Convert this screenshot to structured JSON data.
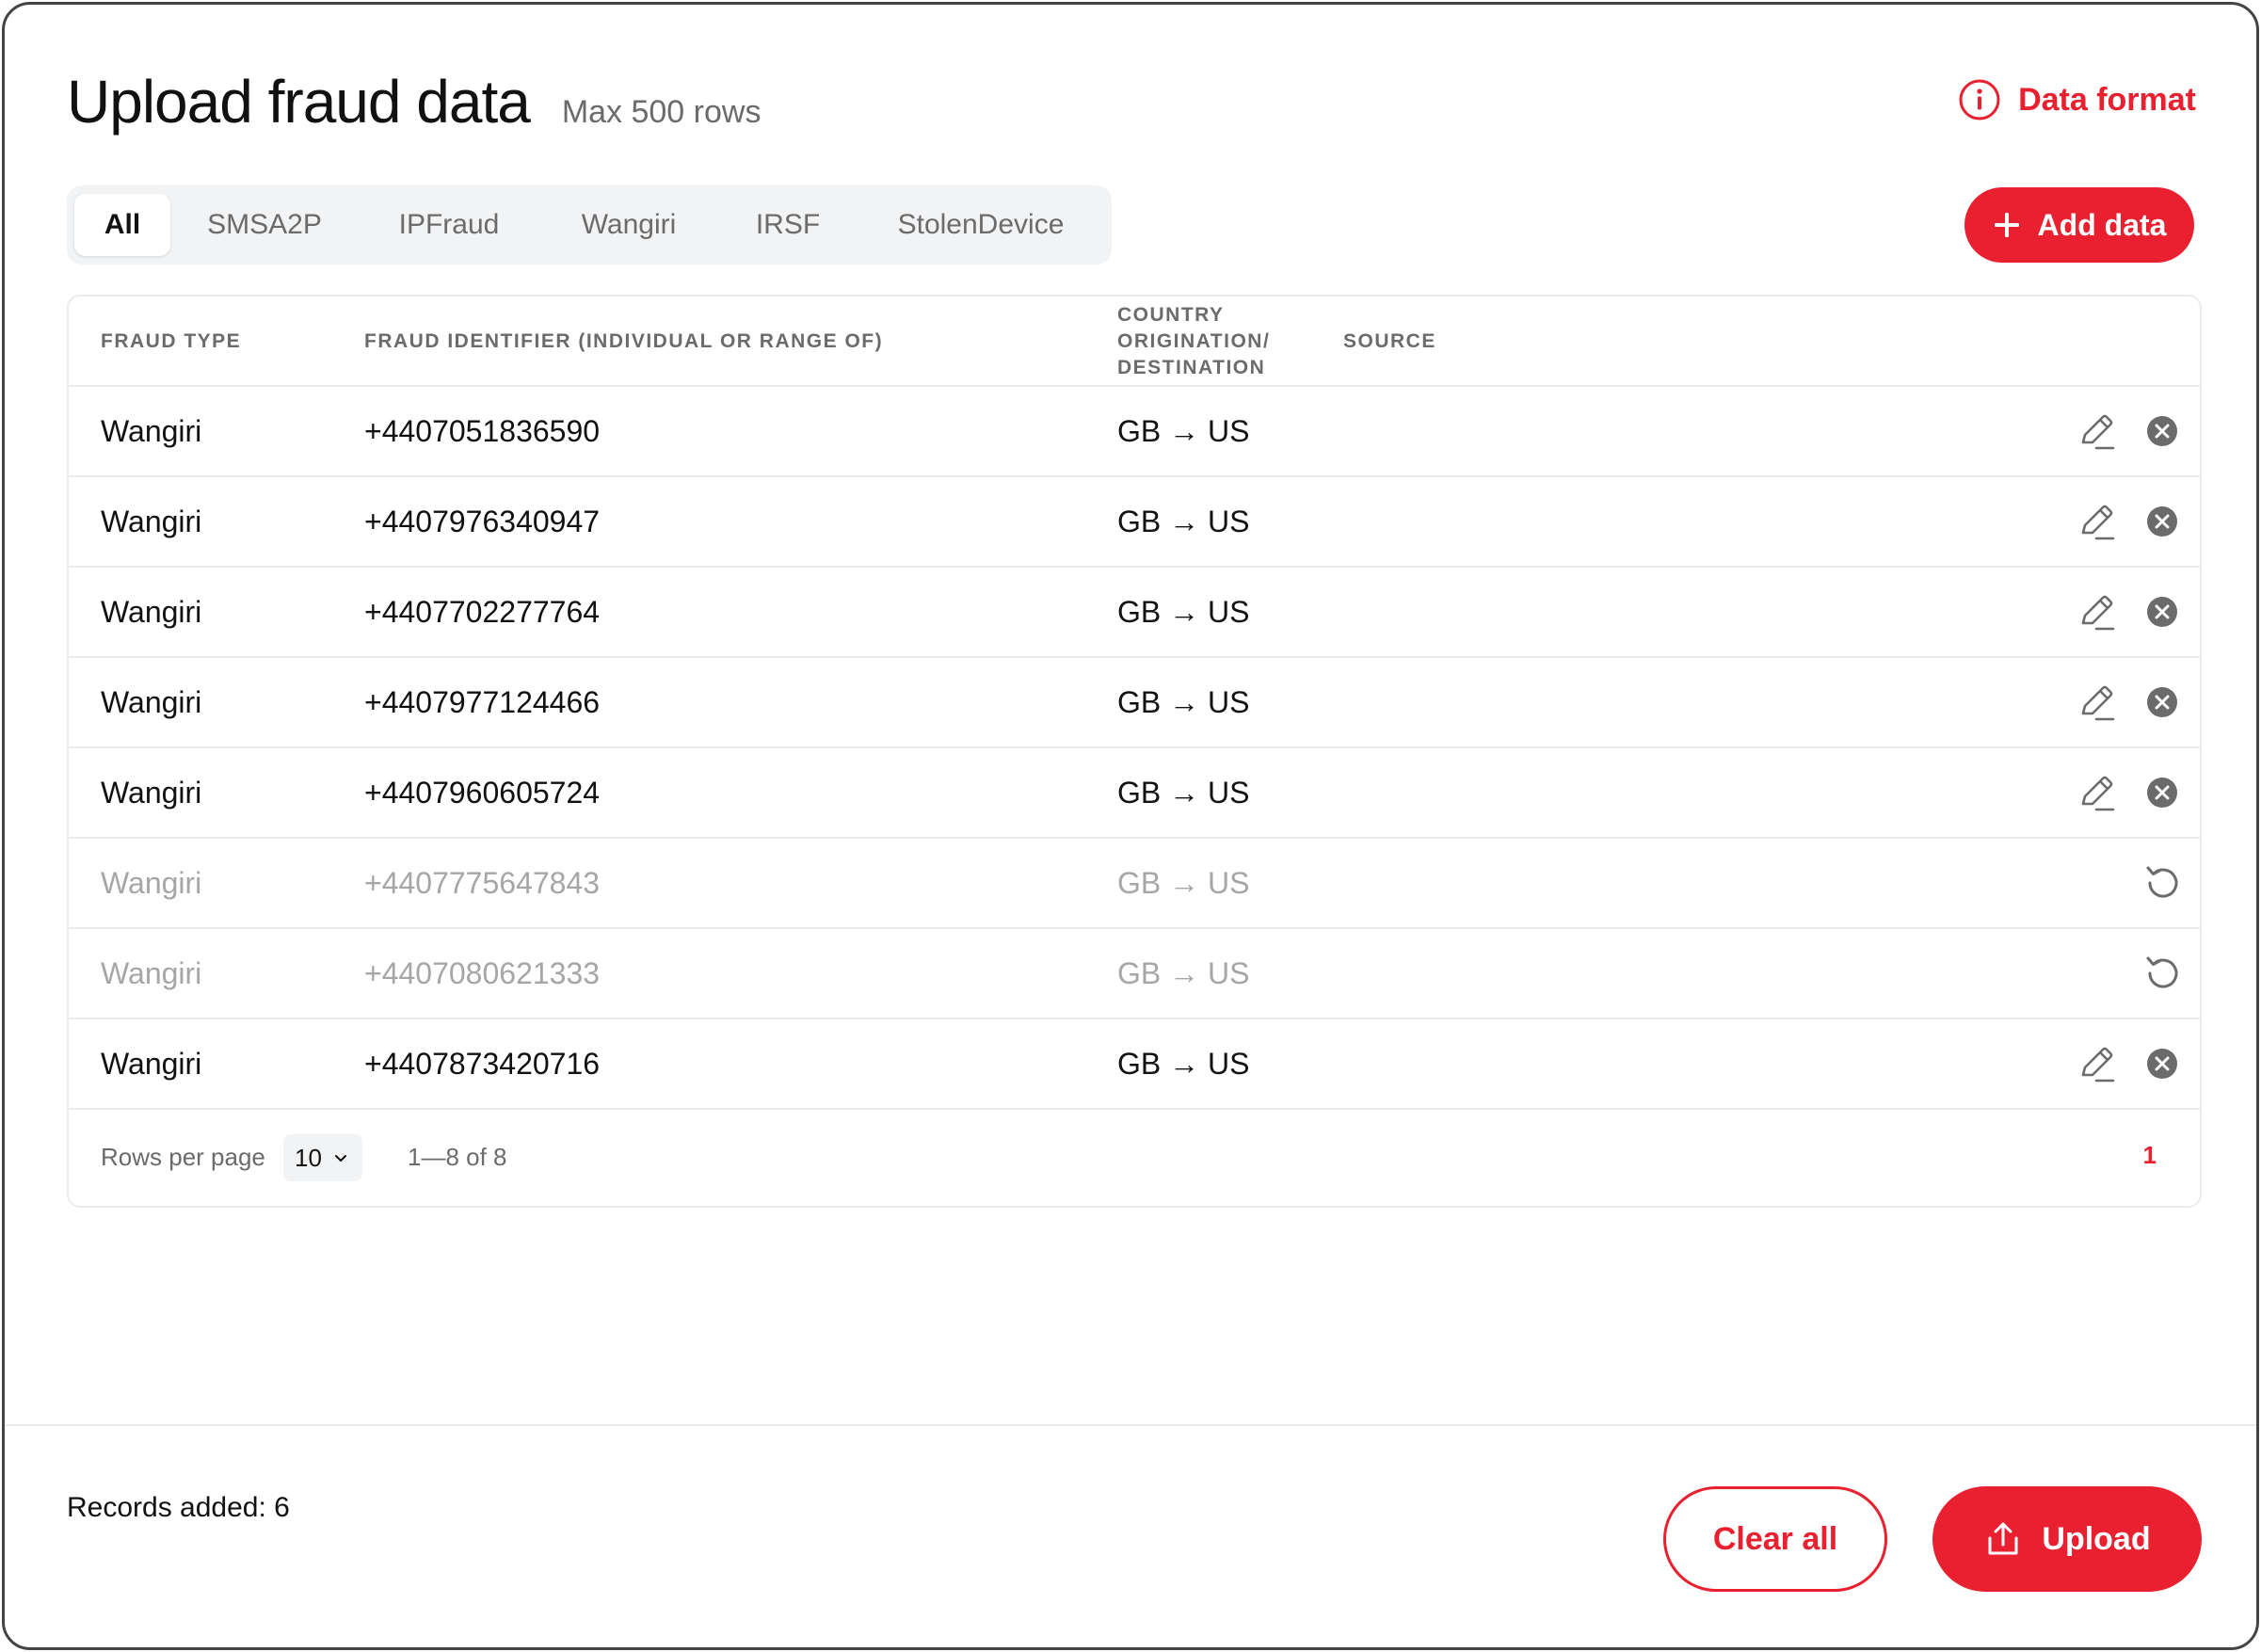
{
  "header": {
    "title": "Upload fraud data",
    "subtitle": "Max 500 rows",
    "data_format_label": "Data format",
    "info_icon": "info-icon"
  },
  "tabs": [
    {
      "label": "All",
      "active": true
    },
    {
      "label": "SMSA2P",
      "active": false
    },
    {
      "label": "IPFraud",
      "active": false
    },
    {
      "label": "Wangiri",
      "active": false
    },
    {
      "label": "IRSF",
      "active": false
    },
    {
      "label": "StolenDevice",
      "active": false
    }
  ],
  "add_button": {
    "label": "Add data",
    "icon": "plus-icon"
  },
  "table": {
    "columns": [
      "FRAUD TYPE",
      "FRAUD IDENTIFIER (INDIVIDUAL OR RANGE OF)",
      "COUNTRY ORIGINATION/ DESTINATION",
      "SOURCE"
    ],
    "rows": [
      {
        "type": "Wangiri",
        "identifier": "+4407051836590",
        "route": "GB → US",
        "state": "active"
      },
      {
        "type": "Wangiri",
        "identifier": "+4407976340947",
        "route": "GB → US",
        "state": "active"
      },
      {
        "type": "Wangiri",
        "identifier": "+4407702277764",
        "route": "GB → US",
        "state": "active"
      },
      {
        "type": "Wangiri",
        "identifier": "+4407977124466",
        "route": "GB → US",
        "state": "active"
      },
      {
        "type": "Wangiri",
        "identifier": "+4407960605724",
        "route": "GB → US",
        "state": "active"
      },
      {
        "type": "Wangiri",
        "identifier": "+4407775647843",
        "route": "GB → US",
        "state": "removed"
      },
      {
        "type": "Wangiri",
        "identifier": "+4407080621333",
        "route": "GB → US",
        "state": "removed"
      },
      {
        "type": "Wangiri",
        "identifier": "+4407873420716",
        "route": "GB → US",
        "state": "active"
      }
    ],
    "row_icons": {
      "edit": "pencil-icon",
      "remove": "close-circle-icon",
      "restore": "undo-icon"
    }
  },
  "pagination": {
    "rows_per_page_label": "Rows per page",
    "rows_per_page_value": "10",
    "range_text": "1—8 of 8",
    "current_page": "1"
  },
  "footer": {
    "records_added": "Records added: 6",
    "clear_all_label": "Clear all",
    "upload_label": "Upload",
    "upload_icon": "upload-icon"
  },
  "colors": {
    "accent": "#e8202f",
    "muted_text": "#6b6b6b",
    "disabled_text": "#a6a6a6",
    "tab_bg": "#f2f3f5"
  }
}
